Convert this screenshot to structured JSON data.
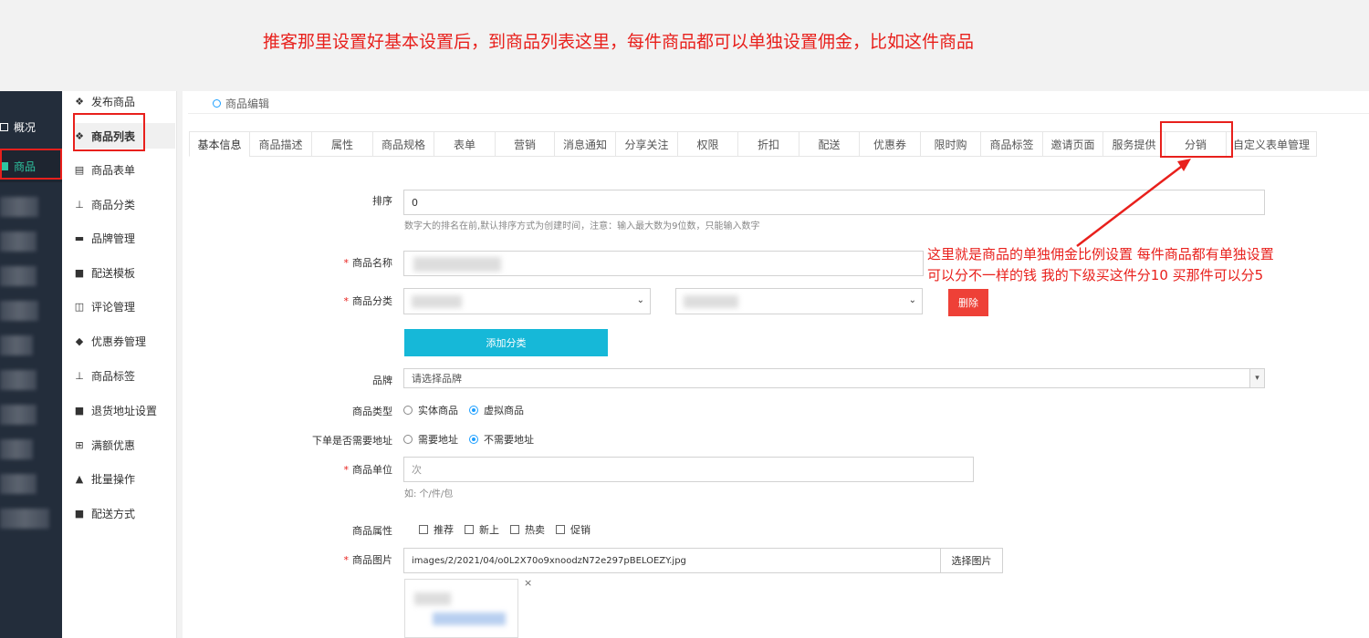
{
  "banner": {
    "text": "推客那里设置好基本设置后，到商品列表这里，每件商品都可以单独设置佣金，比如这件商品"
  },
  "dark_sidebar": {
    "overview": "概况",
    "goods": "商品"
  },
  "sub_sidebar": {
    "items": [
      {
        "label": "发布商品",
        "icon": "cubes-icon"
      },
      {
        "label": "商品列表",
        "icon": "cubes-icon"
      },
      {
        "label": "商品表单",
        "icon": "file-icon"
      },
      {
        "label": "商品分类",
        "icon": "sitemap-icon"
      },
      {
        "label": "品牌管理",
        "icon": "briefcase-icon"
      },
      {
        "label": "配送模板",
        "icon": "truck-icon"
      },
      {
        "label": "评论管理",
        "icon": "columns-icon"
      },
      {
        "label": "优惠券管理",
        "icon": "tags-icon"
      },
      {
        "label": "商品标签",
        "icon": "sitemap-icon"
      },
      {
        "label": "退货地址设置",
        "icon": "truck-icon"
      },
      {
        "label": "满额优惠",
        "icon": "gift-icon"
      },
      {
        "label": "批量操作",
        "icon": "thumbs-up-icon"
      },
      {
        "label": "配送方式",
        "icon": "truck-icon"
      }
    ]
  },
  "breadcrumb": "商品编辑",
  "tabs": [
    "基本信息",
    "商品描述",
    "属性",
    "商品规格",
    "表单",
    "营销",
    "消息通知",
    "分享关注",
    "权限",
    "折扣",
    "配送",
    "优惠券",
    "限时购",
    "商品标签",
    "邀请页面",
    "服务提供",
    "分销",
    "自定义表单管理"
  ],
  "form": {
    "sort_label": "排序",
    "sort_value": "0",
    "sort_hint": "数字大的排名在前,默认排序方式为创建时间，注意：输入最大数为9位数，只能输入数字",
    "name_label": "商品名称",
    "category_label": "商品分类",
    "delete_button": "删除",
    "add_category_button": "添加分类",
    "brand_label": "品牌",
    "brand_placeholder": "请选择品牌",
    "type_label": "商品类型",
    "type_options": [
      "实体商品",
      "虚拟商品"
    ],
    "address_label": "下单是否需要地址",
    "address_options": [
      "需要地址",
      "不需要地址"
    ],
    "unit_label": "商品单位",
    "unit_placeholder": "次",
    "unit_hint": "如: 个/件/包",
    "attr_label": "商品属性",
    "attr_options": [
      "推荐",
      "新上",
      "热卖",
      "促销"
    ],
    "image_label": "商品图片",
    "image_value": "images/2/2021/04/o0L2X70o9xnoodzN72e297pBELOEZY.jpg",
    "image_button": "选择图片",
    "close_mark": "×"
  },
  "annotation": {
    "line1": "这里就是商品的单独佣金比例设置    每件商品都有单独设置",
    "line2": "可以分不一样的钱 我的下级买这件分10   买那件可以分5"
  },
  "colors": {
    "accent_red": "#e8201c",
    "primary_cyan": "#16b8d8",
    "danger": "#ee4037",
    "sidebar_dark": "#232d3b",
    "active_green": "#2ec4a0"
  }
}
